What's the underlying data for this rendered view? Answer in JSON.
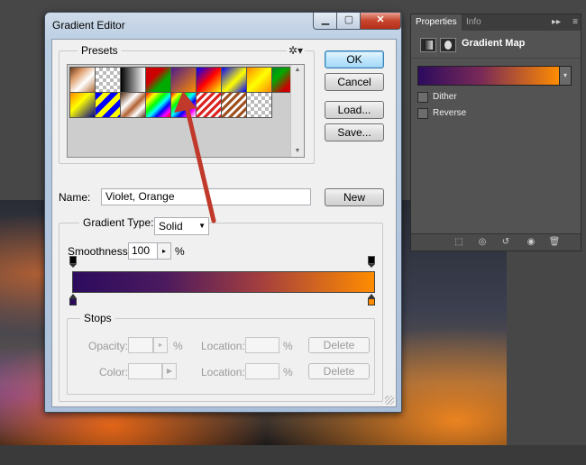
{
  "dialog": {
    "title": "Gradient Editor",
    "window_buttons": {
      "minimize": "▁",
      "maximize": "▢",
      "close": "✕"
    },
    "presets_label": "Presets",
    "gear_icon": "✲▾",
    "presets": [
      "linear-gradient(135deg,#6b3a1a,#e0a070,#fff 60%,#b06a30)",
      "repeating-conic-gradient(#bbb 0 25%, #fff 0 50%) 0 0/8px 8px",
      "linear-gradient(90deg,#000,#fff)",
      "linear-gradient(135deg,#c00 0%,#c00 35%,#0a0 65%,#0a0 100%)",
      "linear-gradient(135deg,#4b1c8a,#ff8c00)",
      "linear-gradient(135deg,#00f,#f00 50%,#ff0)",
      "linear-gradient(135deg,#00f,#ff0 55%,#00f)",
      "linear-gradient(135deg,#f80,#ff0 50%,#f80)",
      "linear-gradient(135deg,#082 0%,#0a0 30%,#c00 70%,#c00 100%)",
      "linear-gradient(135deg,#f80,#ff0 40%,#008 100%)",
      "repeating-linear-gradient(135deg,#00f 0 6px,#ff0 6px 12px)",
      "linear-gradient(135deg,#5b2b0c,#fff 35%,#b06030 55%,#fff 75%,#5b2b0c)",
      "linear-gradient(135deg,#f00,#ff0 20%,#0f0 40%,#0ff 55%,#00f 70%,#f0f 85%,#f00)",
      "linear-gradient(135deg,#f00,#ff0 16%,#0f0 32%,#0ff 48%,#00f 64%,#f0f 80%,#fff)",
      "repeating-linear-gradient(135deg,#d22 0 3px,#fff 3px 6px)",
      "repeating-linear-gradient(135deg,#a05020 0 3px,#fff 3px 6px)",
      "repeating-conic-gradient(#bbb 0 25%, #fff 0 50%) 0 0/8px 8px"
    ],
    "buttons": {
      "ok": "OK",
      "cancel": "Cancel",
      "load": "Load...",
      "save": "Save...",
      "new": "New"
    },
    "name_label": "Name:",
    "name_value": "Violet, Orange",
    "gradient_type_label": "Gradient Type:",
    "gradient_type_value": "Solid",
    "smoothness_label": "Smoothness:",
    "smoothness_value": "100",
    "smoothness_unit": "%",
    "gradient": {
      "start_color": "#2c0b5e",
      "end_color": "#ff8c00"
    },
    "stops": {
      "label": "Stops",
      "opacity_label": "Opacity:",
      "opacity_unit": "%",
      "color_label": "Color:",
      "location_label": "Location:",
      "location_unit": "%",
      "delete_label": "Delete"
    }
  },
  "properties_panel": {
    "tabs": [
      "Properties",
      "Info"
    ],
    "collapse_icon": "▸▸",
    "menu_icon": "≡",
    "title": "Gradient Map",
    "dither_label": "Dither",
    "reverse_label": "Reverse",
    "dropdown_icon": "▾"
  },
  "colors": {
    "violet": "#2c0b5e",
    "orange": "#ff8c00",
    "annotation_arrow": "#c0392b"
  }
}
